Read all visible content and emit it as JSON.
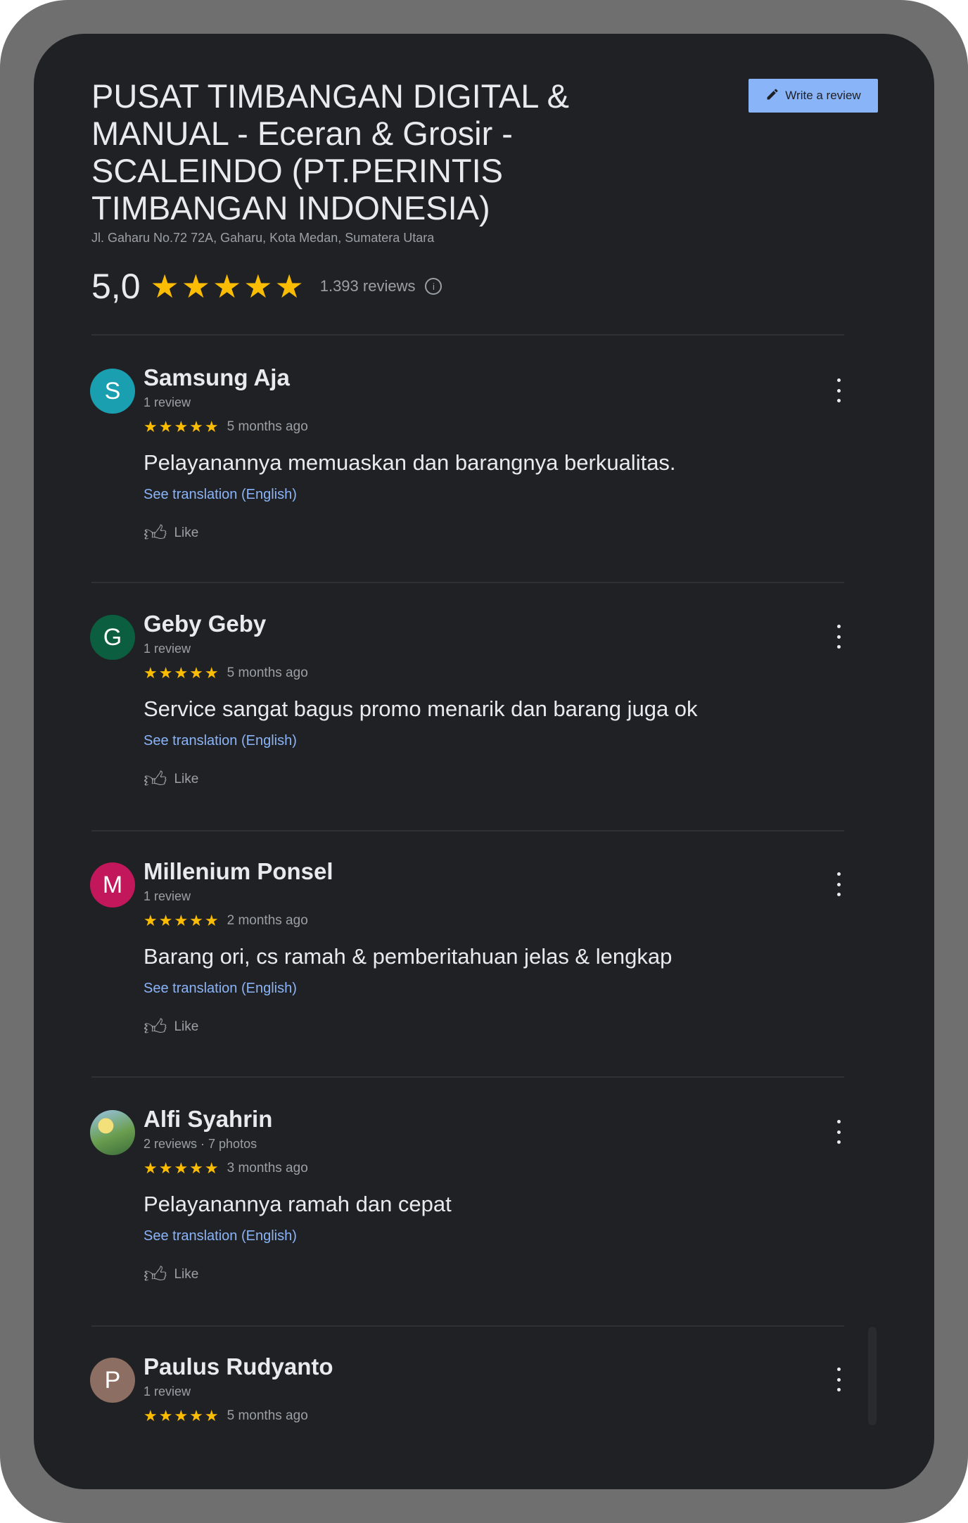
{
  "place": {
    "title": "PUSAT TIMBANGAN DIGITAL & MANUAL - Eceran & Grosir - SCALEINDO (PT.PERINTIS TIMBANGAN INDONESIA)",
    "address": "Jl. Gaharu No.72 72A, Gaharu, Kota Medan, Sumatera Utara",
    "rating": "5,0",
    "rating_stars": 5,
    "reviews_count": "1.393 reviews",
    "write_review_label": "Write a review"
  },
  "colors": {
    "background": "#202124",
    "star": "#fbbc04",
    "link": "#8ab4f8",
    "button": "#8ab4f8"
  },
  "reviews": [
    {
      "avatar_letter": "S",
      "avatar_color": "#1a9fb0",
      "author": "Samsung Aja",
      "meta": "1 review",
      "stars": 5,
      "time": "5 months ago",
      "text": "Pelayanannya memuaskan dan barangnya berkualitas.",
      "translate": "See translation (English)",
      "like": "Like"
    },
    {
      "avatar_letter": "G",
      "avatar_color": "#0b5e3f",
      "author": "Geby Geby",
      "meta": "1 review",
      "stars": 5,
      "time": "5 months ago",
      "text": "Service sangat bagus promo menarik dan barang juga ok",
      "translate": "See translation (English)",
      "like": "Like"
    },
    {
      "avatar_letter": "M",
      "avatar_color": "#c2185b",
      "author": "Millenium Ponsel",
      "meta": "1 review",
      "stars": 5,
      "time": "2 months ago",
      "text": "Barang ori, cs ramah & pemberitahuan jelas & lengkap",
      "translate": "See translation (English)",
      "like": "Like"
    },
    {
      "avatar_letter": "",
      "avatar_color": "photo",
      "author": "Alfi Syahrin",
      "meta": "2 reviews · 7 photos",
      "stars": 5,
      "time": "3 months ago",
      "text": "Pelayanannya ramah dan cepat",
      "translate": "See translation (English)",
      "like": "Like"
    },
    {
      "avatar_letter": "P",
      "avatar_color": "#8d6e63",
      "author": "Paulus Rudyanto",
      "meta": "1 review",
      "stars": 5,
      "time": "5 months ago",
      "text": "",
      "translate": "",
      "like": ""
    }
  ]
}
